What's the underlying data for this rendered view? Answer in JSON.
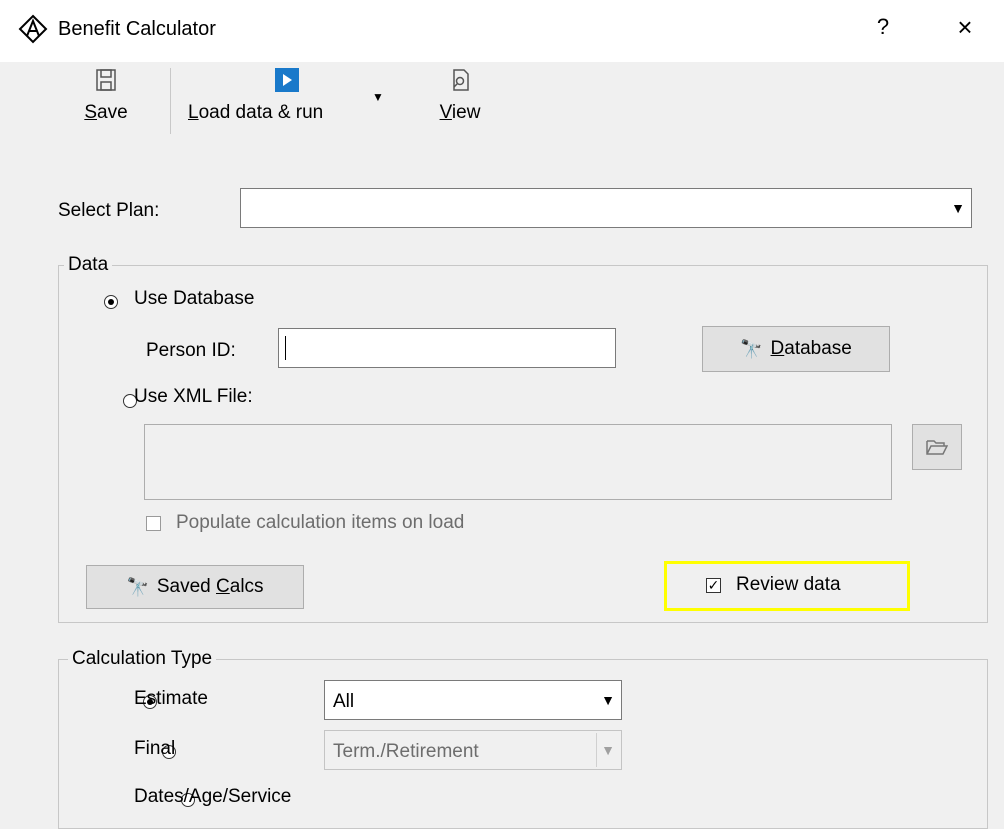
{
  "window": {
    "title": "Benefit Calculator",
    "help": "?",
    "close": "×"
  },
  "toolbar": {
    "save_label": "Save",
    "save_ul": "S",
    "save_rest": "ave",
    "load_ul": "L",
    "load_rest": "oad data & run",
    "view_ul": "V",
    "view_rest": "iew"
  },
  "plan": {
    "label": "Select Plan:",
    "value": ""
  },
  "data_group": {
    "legend": "Data",
    "use_database": "Use Database",
    "person_id_label": "Person ID:",
    "person_id_value": "",
    "database_btn_ul": "D",
    "database_btn_rest": "atabase",
    "use_xml": "Use XML File:",
    "xml_value": "",
    "populate_label": "Populate calculation items on load",
    "saved_calcs_pre": "Saved ",
    "saved_calcs_ul": "C",
    "saved_calcs_rest": "alcs",
    "review_data": "Review data",
    "review_checked": true
  },
  "calc_group": {
    "legend": "Calculation Type",
    "estimate": "Estimate",
    "estimate_value": "All",
    "final": "Final",
    "final_value": "Term./Retirement",
    "dates": "Dates/Age/Service"
  },
  "colors": {
    "highlight": "#ffff00",
    "accent": "#1979ca"
  }
}
